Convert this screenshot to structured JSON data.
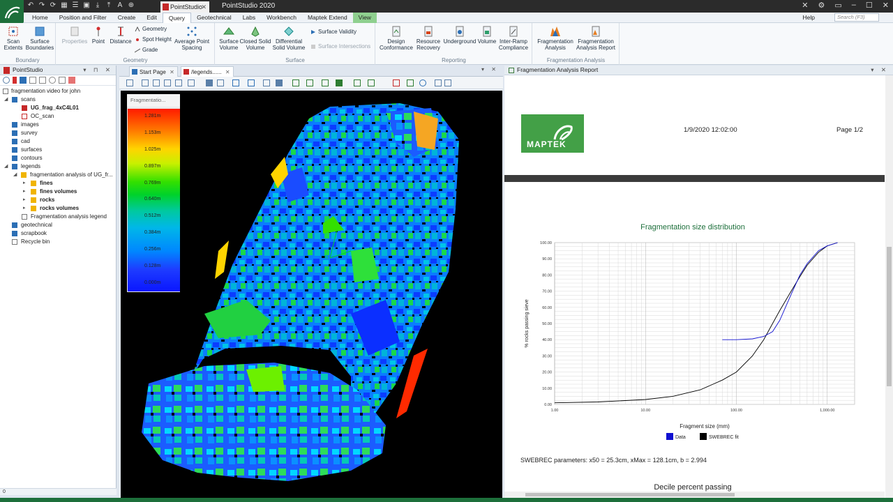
{
  "app": {
    "tab_label": "PointStudio",
    "window_title": "PointStudio 2020"
  },
  "menu": {
    "tabs": [
      "Home",
      "Position and Filter",
      "Create",
      "Edit",
      "Query",
      "Geotechnical",
      "Labs",
      "Workbench",
      "Maptek Extend",
      "View"
    ],
    "active_tab": "Query",
    "help": "Help",
    "search_placeholder": "Search (F3)"
  },
  "ribbon": {
    "boundary": {
      "name": "Boundary",
      "scan_extents": "Scan Extents",
      "surface_boundaries": "Surface Boundaries"
    },
    "geometry": {
      "name": "Geometry",
      "properties": "Properties",
      "point": "Point",
      "distance": "Distance",
      "geometry": "Geometry",
      "spot_height": "Spot Height",
      "grade": "Grade",
      "average_point_spacing": "Average Point Spacing"
    },
    "surface": {
      "name": "Surface",
      "surface_volume": "Surface Volume",
      "closed_solid_volume": "Closed Solid Volume",
      "differential_solid_volume": "Differential Solid Volume",
      "surface_validity": "Surface Validity",
      "surface_intersections": "Surface Intersections"
    },
    "reporting": {
      "name": "Reporting",
      "design_conformance": "Design Conformance",
      "resource_recovery": "Resource Recovery",
      "underground": "Underground",
      "volume": "Volume",
      "inter_ramp_compliance": "Inter-Ramp Compliance"
    },
    "fragmentation": {
      "name": "Fragmentation Analysis",
      "fragmentation_analysis": "Fragmentation Analysis",
      "fragmentation_analysis_report": "Fragmentation Analysis Report"
    }
  },
  "left_panel": {
    "title": "PointStudio",
    "root": "fragmentation video for john",
    "items": {
      "scans": "scans",
      "scan1": "UG_frag_4xC4L01",
      "scan2": "OC_scan",
      "images": "images",
      "survey": "survey",
      "cad": "cad",
      "surfaces": "surfaces",
      "contours": "contours",
      "legends": "legends",
      "frag_analysis": "fragmentation analysis of UG_fr...",
      "fines": "fines",
      "fines_volumes": "fines volumes",
      "rocks": "rocks",
      "rocks_volumes": "rocks volumes",
      "frag_legend": "Fragmentation analysis legend",
      "geotechnical": "geotechnical",
      "scrapbook": "scrapbook",
      "recycle_bin": "Recycle bin"
    },
    "status": "0"
  },
  "middle_panel": {
    "tab_start": "Start Page",
    "tab_legends": "/legends......",
    "legend_title": "Fragmentatio...",
    "legend_values": [
      "1.281m",
      "1.153m",
      "1.025m",
      "0.897m",
      "0.769m",
      "0.640m",
      "0.512m",
      "0.384m",
      "0.256m",
      "0.128m",
      "0.000m"
    ],
    "north_label": "N"
  },
  "right_panel": {
    "title": "Fragmentation Analysis Report",
    "logo_text": "MAPTEK",
    "date": "1/9/2020 12:02:00",
    "page": "Page 1/2",
    "chart_title": "Fragmentation size distribution",
    "swebrec": "SWEBREC parameters: x50 = 25.3cm, xMax = 128.1cm, b = 2.994",
    "decile_heading": "Decile percent passing"
  },
  "chart_data": {
    "type": "line",
    "title": "Fragmentation size distribution",
    "xlabel": "Fragment size (mm)",
    "ylabel": "% rocks passing sieve",
    "xscale": "log",
    "xlim": [
      1,
      2000
    ],
    "ylim": [
      0,
      100
    ],
    "x_ticks": [
      "1.00",
      "10.00",
      "100.00",
      "1,000.00"
    ],
    "y_ticks": [
      "0.00",
      "10.00",
      "20.00",
      "30.00",
      "40.00",
      "50.00",
      "60.00",
      "70.00",
      "80.00",
      "90.00",
      "100.00"
    ],
    "legend_position": "bottom",
    "grid": true,
    "series": [
      {
        "name": "Data",
        "color": "#1010d0",
        "x": [
          70,
          100,
          150,
          200,
          250,
          300,
          400,
          500,
          600,
          800,
          1000,
          1300
        ],
        "y": [
          40,
          40,
          40.5,
          42,
          45,
          52,
          68,
          80,
          87,
          95,
          98,
          100
        ]
      },
      {
        "name": "SWEBREC fit",
        "color": "#000000",
        "x": [
          1,
          3,
          10,
          20,
          40,
          70,
          100,
          150,
          200,
          250,
          300,
          400,
          500,
          600,
          800,
          1000,
          1300
        ],
        "y": [
          1,
          1.5,
          3,
          5,
          9,
          15,
          20,
          30,
          40,
          50,
          58,
          70,
          79,
          86,
          94,
          98,
          100
        ]
      }
    ]
  }
}
